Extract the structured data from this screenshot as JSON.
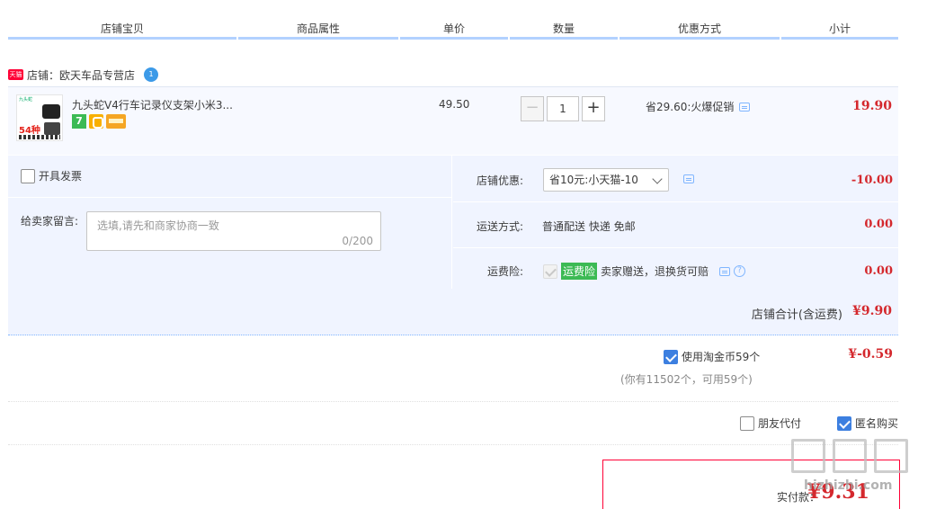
{
  "header": {
    "columns": [
      "店铺宝贝",
      "商品属性",
      "单价",
      "数量",
      "优惠方式",
      "小计"
    ]
  },
  "shop": {
    "badge_text": "天猫",
    "label": "店铺：欧天车品专营店",
    "badge_count": "1"
  },
  "item": {
    "title": "九头蛇V4行车记录仪支架小米3...",
    "thumb_big_text": "54种",
    "price": "49.50",
    "quantity": "1",
    "minus_label": "−",
    "plus_label": "+",
    "promo": "省29.60:火爆促销",
    "subtotal": "19.90",
    "icon_7": "7"
  },
  "options": {
    "invoice_label": "开具发票",
    "message_label": "给卖家留言:",
    "message_placeholder": "选填,请先和商家协商一致",
    "message_count": "0/200",
    "shop_discount_label": "店铺优惠:",
    "shop_discount_value": "省10元:小天猫-10",
    "shop_discount_amount": "-10.00",
    "shipping_label": "运送方式:",
    "shipping_value": "普通配送 快递 免邮",
    "shipping_amount": "0.00",
    "insurance_label": "运费险:",
    "insurance_tag": "运费险",
    "insurance_text": "卖家赠送，退换货可赔",
    "insurance_amount": "0.00",
    "help_icon": "?"
  },
  "shop_total": {
    "label": "店铺合计(含运费)",
    "amount": "¥9.90"
  },
  "coins": {
    "label": "使用淘金币59个",
    "amount": "¥-0.59",
    "note": "(你有11502个，可用59个)"
  },
  "options2": {
    "friend_pay": "朋友代付",
    "anonymous": "匿名购买"
  },
  "pay": {
    "label": "实付款：",
    "amount": "¥9.31"
  },
  "watermark": {
    "text": "hizhizhi.com"
  },
  "colors": {
    "accent_red": "#d4282d",
    "header_line": "#b2d1ff",
    "row_bg": "#f0f4ff"
  }
}
